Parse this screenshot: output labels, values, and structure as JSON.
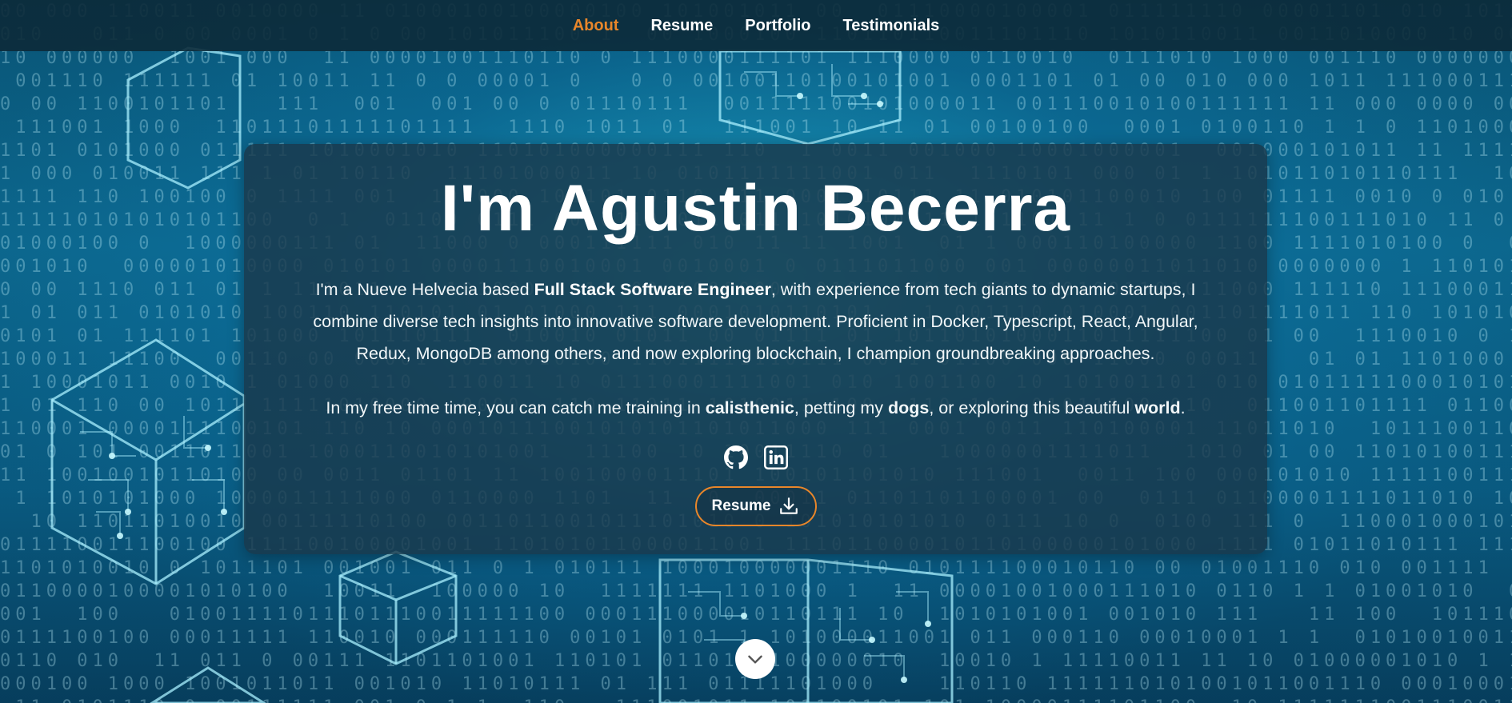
{
  "nav": {
    "items": [
      {
        "label": "About",
        "active": true
      },
      {
        "label": "Resume",
        "active": false
      },
      {
        "label": "Portfolio",
        "active": false
      },
      {
        "label": "Testimonials",
        "active": false
      }
    ]
  },
  "hero": {
    "title": "I'm Agustin Becerra",
    "bio": {
      "part1": "I'm a Nueve Helvecia based ",
      "role": "Full Stack Software Engineer",
      "part2": ", with experience from tech giants to dynamic startups, I combine diverse tech insights into innovative software development. Proficient in Docker, Typescript, React, Angular, Redux, MongoDB among others, and now exploring blockchain, I champion groundbreaking approaches."
    },
    "hobbies": {
      "part1": "In my free time time, you can catch me training in ",
      "hobby1": "calisthenic",
      "part2": ", petting my ",
      "hobby2": "dogs",
      "part3": ", or exploring this beautiful ",
      "hobby3": "world",
      "part4": "."
    },
    "socials": [
      {
        "icon": "github-icon"
      },
      {
        "icon": "linkedin-icon"
      }
    ],
    "resume_button": {
      "label": "Resume",
      "icon": "download-icon"
    },
    "scroll_icon": "chevron-down-icon"
  },
  "colors": {
    "accent": "#e8862a",
    "nav_bg": "#0c2a38",
    "card_bg": "#1a384a",
    "text": "#ffffff"
  }
}
